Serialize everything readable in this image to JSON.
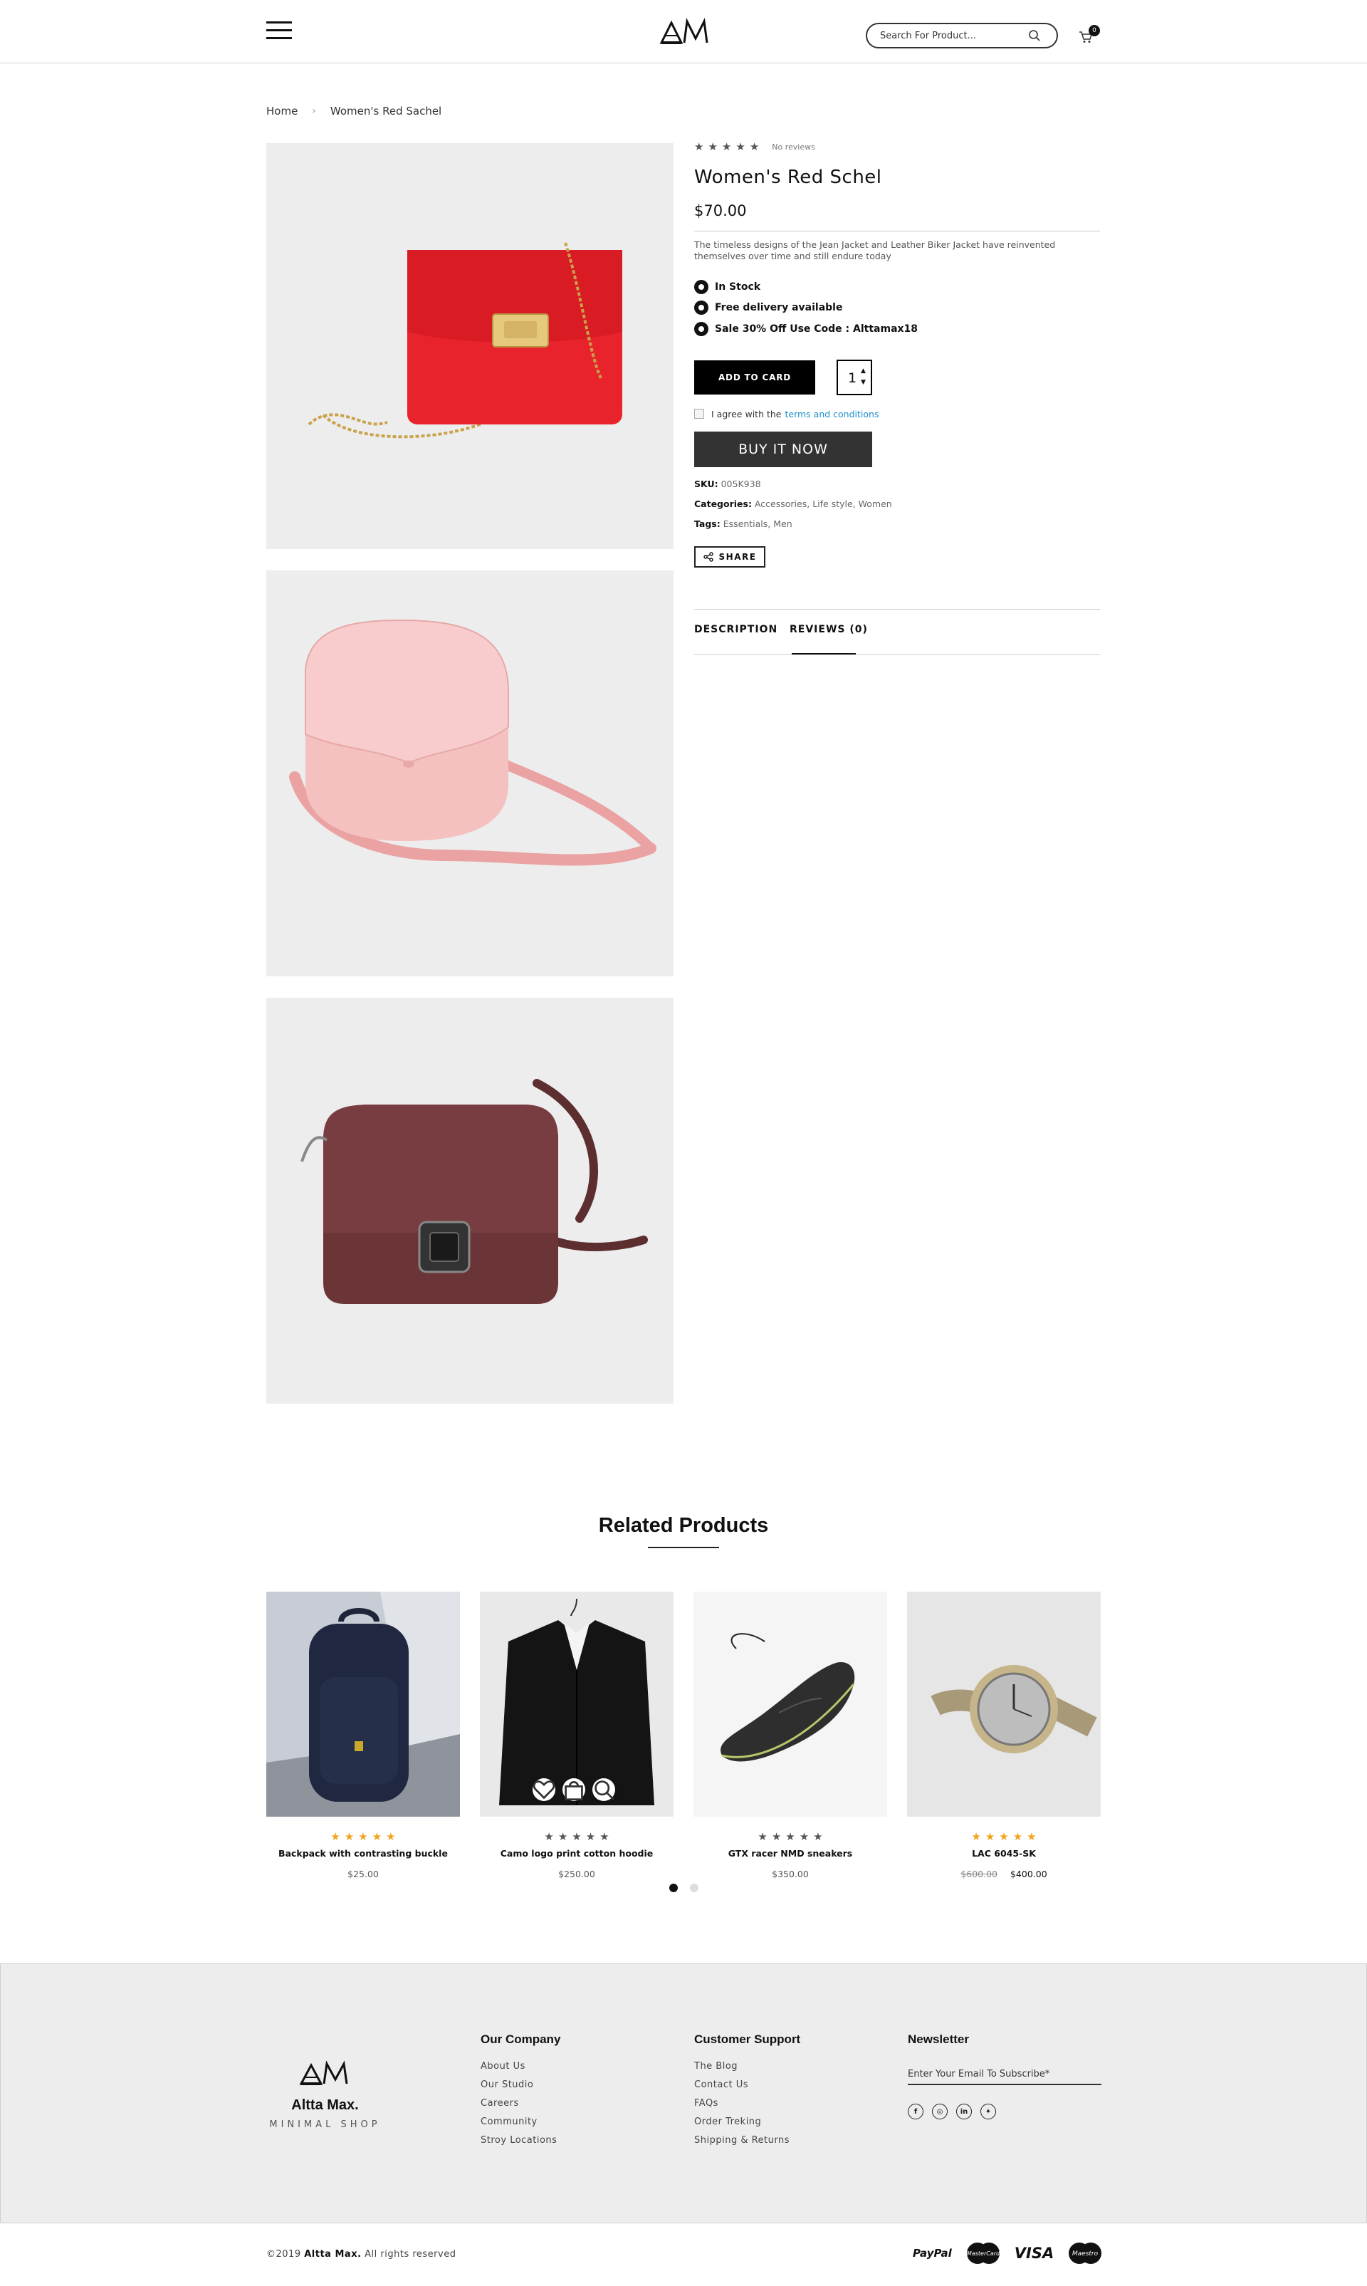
{
  "header": {
    "search_placeholder": "Search For Product...",
    "cart_count": "0"
  },
  "breadcrumb": {
    "home": "Home",
    "current": "Women's Red Sachel"
  },
  "gallery": {
    "images": [
      {
        "icon": "red-handbag-image",
        "color": "#e8232c"
      },
      {
        "icon": "pink-handbag-image",
        "color": "#f3b9b9"
      },
      {
        "icon": "brown-handbag-image",
        "color": "#6b3538"
      }
    ]
  },
  "product": {
    "rating": 0,
    "reviews_label": "No reviews",
    "title": "Women's Red Schel",
    "price": "$70.00",
    "description": "The timeless designs of the Jean Jacket and Leather Biker Jacket have reinvented themselves over time and still endure today",
    "features": [
      "In Stock",
      "Free delivery available",
      "Sale 30% Off Use Code : Alttamax18"
    ],
    "add_to_cart_label": "ADD TO CARD",
    "quantity": "1",
    "agree_text": "I agree with the",
    "terms_link": "terms and conditions",
    "buy_now_label": "BUY IT NOW",
    "sku_label": "SKU:",
    "sku_value": "005K938",
    "categories_label": "Categories:",
    "categories": [
      "Accessories",
      "Life style",
      "Women"
    ],
    "tags_label": "Tags:",
    "tags": [
      "Essentials",
      "Men"
    ],
    "share_label": "SHARE",
    "tabs": [
      {
        "label": "DESCRIPTION",
        "active": false
      },
      {
        "label": "REVIEWS (0)",
        "active": true
      }
    ]
  },
  "related": {
    "title": "Related Products",
    "items": [
      {
        "name": "Backpack with contrasting buckle",
        "price": "$25.00",
        "old_price": "",
        "rating": 5,
        "icon": "backpack-image"
      },
      {
        "name": "Camo logo print cotton hoodie",
        "price": "$250.00",
        "old_price": "",
        "rating": 0,
        "icon": "jacket-image"
      },
      {
        "name": "GTX racer NMD sneakers",
        "price": "$350.00",
        "old_price": "",
        "rating": 0,
        "icon": "sneaker-image"
      },
      {
        "name": "LAC 6045-SK",
        "price": "$400.00",
        "old_price": "$600.00",
        "rating": 5,
        "icon": "watch-image"
      }
    ],
    "dots": 2,
    "active_dot": 0
  },
  "footer": {
    "brand": "Altta Max.",
    "tagline": "MINIMAL SHOP",
    "company": {
      "title": "Our Company",
      "links": [
        "About Us",
        "Our Studio",
        "Careers",
        "Community",
        "Stroy Locations"
      ]
    },
    "support": {
      "title": "Customer Support",
      "links": [
        "The Blog",
        "Contact Us",
        "FAQs",
        "Order Treking",
        "Shipping & Returns"
      ]
    },
    "newsletter": {
      "title": "Newsletter",
      "placeholder": "Enter Your Email To Subscribe*",
      "socials": [
        "facebook-icon",
        "instagram-icon",
        "linkedin-icon",
        "twitter-icon"
      ]
    },
    "copyright_prefix": "©2019",
    "copyright_brand": "Altta Max.",
    "copyright_suffix": "All rights reserved",
    "payments": [
      "PayPal",
      "MasterCard",
      "VISA",
      "Maestro"
    ]
  },
  "colors": {
    "accent_star": "#f3a21a",
    "link": "#1a8fc9",
    "gallery_bg": "#ededed",
    "footer_bg": "#ededed"
  }
}
